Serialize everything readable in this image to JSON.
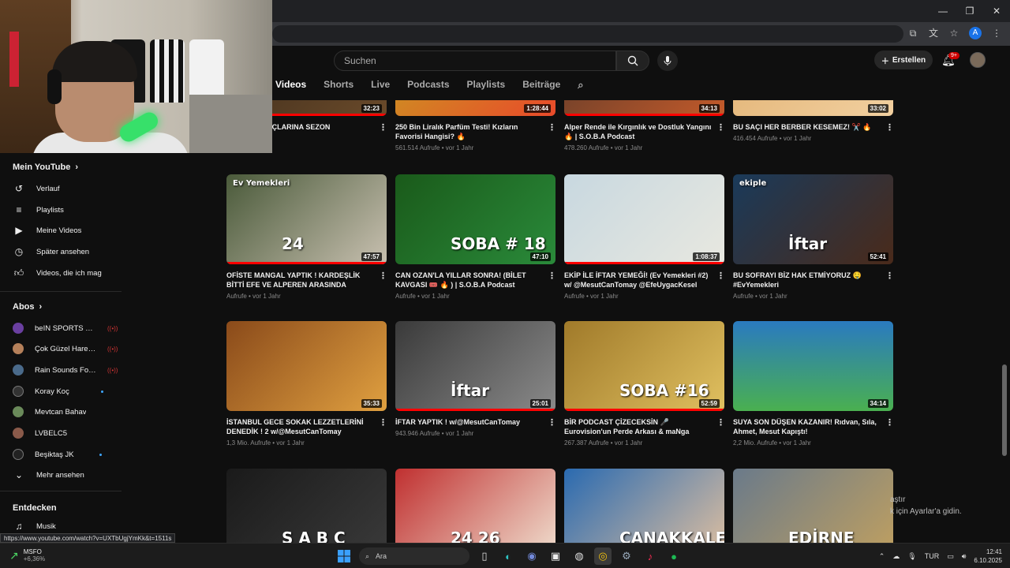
{
  "header": {
    "search_placeholder": "Suchen",
    "create_label": "Erstellen",
    "notif_count": "9+",
    "profile_letter": "A"
  },
  "tabs": [
    "Videos",
    "Shorts",
    "Live",
    "Podcasts",
    "Playlists",
    "Beiträge"
  ],
  "sidebar": {
    "you_title": "Mein YouTube",
    "you_items": [
      {
        "label": "Verlauf",
        "icon": "history-icon"
      },
      {
        "label": "Playlists",
        "icon": "playlists-icon"
      },
      {
        "label": "Meine Videos",
        "icon": "my-videos-icon"
      },
      {
        "label": "Später ansehen",
        "icon": "watch-later-icon"
      },
      {
        "label": "Videos, die ich mag",
        "icon": "like-icon"
      }
    ],
    "subs_title": "Abos",
    "subs": [
      {
        "label": "beIN SPORTS Tü...",
        "color": "#6a3fa0",
        "live": true
      },
      {
        "label": "Çok Güzel Harek...",
        "color": "#b5805a",
        "live": true
      },
      {
        "label": "Rain Sounds For ...",
        "color": "#4a6a8a",
        "live": true
      },
      {
        "label": "Koray Koç",
        "color": "#333333",
        "dot": true
      },
      {
        "label": "Mevtcan Bahav",
        "color": "#6a8a5a"
      },
      {
        "label": "LVBELC5",
        "color": "#8a5a4a"
      },
      {
        "label": "Beşiktaş JK",
        "color": "#222222",
        "dot": true
      }
    ],
    "more_label": "Mehr ansehen",
    "explore_title": "Entdecken",
    "explore_items": [
      {
        "label": "Musik",
        "icon": "music-icon"
      }
    ]
  },
  "videos": [
    {
      "title": "TOMAY'IN SAÇLARINA SEZON",
      "meta": "",
      "duration": "32:23",
      "progress": 1.0,
      "bg": "linear-gradient(135deg,#3a2a1a,#6a4a2a)"
    },
    {
      "title": "250 Bin Liralık Parfüm Testi! Kızların Favorisi Hangisi? 🔥",
      "meta": "561.514 Aufrufe • vor 1 Jahr",
      "duration": "1:28:44",
      "progress": 0.0,
      "bg": "linear-gradient(135deg,#c7a020,#e94a2a)"
    },
    {
      "title": "Alper Rende ile Kırgınlık ve Dostluk Yangını 🔥 | S.O.B.A Podcast",
      "meta": "478.260 Aufrufe • vor 1 Jahr",
      "duration": "34:13",
      "progress": 1.0,
      "bg": "linear-gradient(135deg,#5a3a2a,#c45a2a)"
    },
    {
      "title": "BU SAÇI HER BERBER KESEMEZ! ✂️ 🔥",
      "meta": "416.454 Aufrufe • vor 1 Jahr",
      "duration": "33:02",
      "progress": 0.0,
      "bg": "linear-gradient(135deg,#e0b070,#f2d0a0)"
    },
    {
      "title": "OFİSTE MANGAL YAPTIK ! KARDEŞLİK BİTTİ EFE VE ALPEREN ARASINDA GERİLİ...",
      "meta": "Aufrufe • vor 1 Jahr",
      "duration": "47:57",
      "progress": 1.0,
      "bg": "linear-gradient(135deg,#4a5a3a,#c8c0b0)",
      "overlay": "24",
      "overlay2": "Ev Yemekleri"
    },
    {
      "title": "CAN OZAN'LA YILLAR SONRA! (BİLET KAVGASI 🎟️ 🔥 ) | S.O.B.A Podcast",
      "meta": "Aufrufe • vor 1 Jahr",
      "duration": "47:10",
      "progress": 0.0,
      "bg": "linear-gradient(135deg,#1a5a1a,#2a8a3a)",
      "overlay": "SOBA # 18"
    },
    {
      "title": "EKİP İLE İFTAR YEMEĞİ! (Ev Yemekleri #2) w/ @MesutCanTomay @EfeUygacKesel",
      "meta": "Aufrufe • vor 1 Jahr",
      "duration": "1:08:37",
      "progress": 1.0,
      "bg": "linear-gradient(135deg,#c8d8e0,#e8e8e0)"
    },
    {
      "title": "BU SOFRAYI BİZ HAK ETMİYORUZ 🤤 #EvYemekleri",
      "meta": "Aufrufe • vor 1 Jahr",
      "duration": "52:41",
      "progress": 0.0,
      "bg": "linear-gradient(135deg,#1a3a5a,#4a2a1a)",
      "overlay": "İftar",
      "overlay2": "ekiple"
    },
    {
      "title": "İSTANBUL GECE SOKAK LEZZETLERİNİ DENEDİK ! 2 w/@MesutCanTomay",
      "meta": "1,3 Mio. Aufrufe • vor 1 Jahr",
      "duration": "35:33",
      "progress": 0.0,
      "bg": "linear-gradient(135deg,#8a4a1a,#e0a040)"
    },
    {
      "title": "İFTAR YAPTIK ! w/@MesutCanTomay",
      "meta": "943.946 Aufrufe • vor 1 Jahr",
      "duration": "25:01",
      "progress": 1.0,
      "bg": "linear-gradient(135deg,#3a3a3a,#8a8a8a)",
      "overlay": "İftar"
    },
    {
      "title": "BİR PODCAST ÇİZECEKSİN 🎤 Eurovision'un Perde Arkası & maNga Hikayeleri | S.O.B.A...",
      "meta": "267.387 Aufrufe • vor 1 Jahr",
      "duration": "52:59",
      "progress": 1.0,
      "bg": "linear-gradient(135deg,#a07a2a,#e0c060)",
      "overlay": "SOBA #16"
    },
    {
      "title": "SUYA SON DÜŞEN KAZANIR! Rıdvan, Sıla, Ahmet, Mesut Kapıştı!",
      "meta": "2,2 Mio. Aufrufe • vor 1 Jahr",
      "duration": "34:14",
      "progress": 0.0,
      "bg": "linear-gradient(180deg,#2a7ac0,#4ab050)"
    },
    {
      "title": "",
      "meta": "",
      "duration": "",
      "progress": 0.0,
      "bg": "linear-gradient(135deg,#1a1a1a,#3a3a3a)",
      "overlay": "S A B C"
    },
    {
      "title": "",
      "meta": "",
      "duration": "",
      "progress": 0.0,
      "bg": "linear-gradient(135deg,#c03030,#f0e0d0)",
      "overlay": "24   26"
    },
    {
      "title": "",
      "meta": "",
      "duration": "",
      "progress": 0.0,
      "bg": "linear-gradient(135deg,#2a6ab0,#e0c0a0)",
      "overlay": "ÇANAKKALE"
    },
    {
      "title": "",
      "meta": "",
      "duration": "",
      "progress": 0.0,
      "bg": "linear-gradient(135deg,#6a7a8a,#c0a060)",
      "overlay": "EDİRNE"
    }
  ],
  "tooltip": {
    "line1": "aştır",
    "line2": "k için Ayarlar'a gidin."
  },
  "status_url": "https://www.youtube.com/watch?v=UXTbUgjYmKk&t=1511s",
  "taskbar": {
    "stock_name": "MSFO",
    "stock_change": "+6,36%",
    "search_label": "Ara",
    "lang": "TUR",
    "time": "12:41",
    "date": "6.10.2025"
  }
}
